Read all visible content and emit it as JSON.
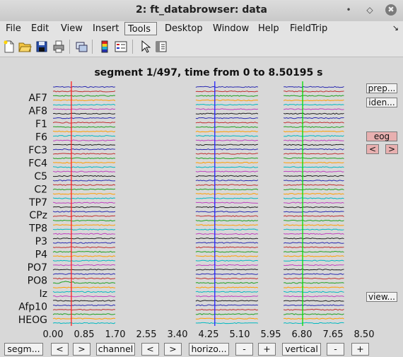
{
  "window": {
    "title": "2: ft_databrowser: data",
    "minimize_glyph": "•",
    "restore_glyph": "◇",
    "close_glyph": "✖"
  },
  "menubar": {
    "items": [
      "File",
      "Edit",
      "View",
      "Insert",
      "Tools",
      "Desktop",
      "Window",
      "Help",
      "FieldTrip"
    ],
    "active": "Tools",
    "pin_glyph": "↘"
  },
  "toolbar": {
    "icons": [
      "new-file-icon",
      "open-folder-icon",
      "save-icon",
      "print-icon",
      "link-figure-icon",
      "colorbar-icon",
      "legend-icon",
      "pointer-icon",
      "property-inspector-icon"
    ]
  },
  "plot": {
    "title": "segment 1/497, time from 0 to 8.50195 s",
    "colors": {
      "red": "#ff2020",
      "blue": "#2020ff",
      "green": "#00dd00"
    }
  },
  "chart_data": {
    "type": "line",
    "title": "segment 1/497, time from 0 to 8.50195 s",
    "xlim": [
      0,
      8.5
    ],
    "xticks": [
      "0.00",
      "0.85",
      "1.70",
      "2.55",
      "3.40",
      "4.25",
      "5.10",
      "5.95",
      "6.80",
      "7.65",
      "8.50"
    ],
    "channel_labels": [
      "AF7",
      "AF8",
      "F1",
      "F6",
      "FC3",
      "FC4",
      "C5",
      "C2",
      "TP7",
      "CPz",
      "TP8",
      "P3",
      "P4",
      "PO7",
      "PO8",
      "Iz",
      "Afp10",
      "HEOG"
    ],
    "trace_count": 54,
    "trace_colors": [
      "#2a2ab0",
      "#c03030",
      "#20a020",
      "#ff9e00",
      "#00b8c0",
      "#c040c0",
      "#202020"
    ],
    "trial_segments": [
      [
        0,
        1.7
      ],
      [
        3.9,
        5.6
      ],
      [
        6.3,
        7.95
      ]
    ],
    "vertical_markers": [
      {
        "x": 0.5,
        "color": "#ff2020"
      },
      {
        "x": 4.42,
        "color": "#2020ff"
      },
      {
        "x": 6.82,
        "color": "#00dd00"
      }
    ]
  },
  "side_buttons": {
    "preproc": "prep...",
    "identify": "iden...",
    "eog": "eog",
    "prev": "<",
    "next": ">",
    "view": "view..."
  },
  "bottom_buttons": {
    "segment": "segm...",
    "seg_prev": "<",
    "seg_next": ">",
    "channel": "channel",
    "ch_prev": "<",
    "ch_next": ">",
    "horizontal": "horizo...",
    "h_minus": "-",
    "h_plus": "+",
    "vertical": "vertical",
    "v_minus": "-",
    "v_plus": "+"
  }
}
